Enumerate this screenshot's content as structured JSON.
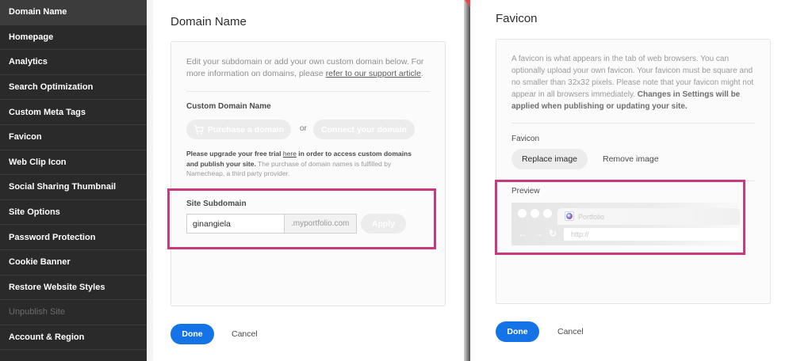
{
  "sidebar": {
    "items": [
      {
        "label": "Domain Name",
        "state": "active"
      },
      {
        "label": "Homepage",
        "state": "normal"
      },
      {
        "label": "Analytics",
        "state": "normal"
      },
      {
        "label": "Search Optimization",
        "state": "normal"
      },
      {
        "label": "Custom Meta Tags",
        "state": "normal"
      },
      {
        "label": "Favicon",
        "state": "normal"
      },
      {
        "label": "Web Clip Icon",
        "state": "normal"
      },
      {
        "label": "Social Sharing Thumbnail",
        "state": "normal"
      },
      {
        "label": "Site Options",
        "state": "normal"
      },
      {
        "label": "Password Protection",
        "state": "normal"
      },
      {
        "label": "Cookie Banner",
        "state": "normal"
      },
      {
        "label": "Restore Website Styles",
        "state": "normal"
      },
      {
        "label": "Unpublish Site",
        "state": "disabled"
      },
      {
        "label": "Account & Region",
        "state": "normal"
      }
    ]
  },
  "domain_panel": {
    "title": "Domain Name",
    "intro_text": "Edit your subdomain or add your own custom domain below. For more information on domains, please ",
    "intro_link": "refer to our support article",
    "intro_end": ".",
    "custom_domain_label": "Custom Domain Name",
    "purchase_button": "Purchase a domain",
    "or_text": "or",
    "connect_button": "Connect your domain",
    "upgrade_note_part1": "Please upgrade your free trial ",
    "upgrade_note_link": "here",
    "upgrade_note_part2": " in order to access custom domains and publish your site.",
    "upgrade_note_part3": " The purchase of domain names is fulfilled by Namecheap, a third party provider.",
    "subdomain_label": "Site Subdomain",
    "subdomain_value": "ginangiela",
    "subdomain_suffix": ".myportfolio.com",
    "apply_button": "Apply",
    "done_button": "Done",
    "cancel_button": "Cancel"
  },
  "favicon_panel": {
    "title": "Favicon",
    "description": "A favicon is what appears in the tab of web browsers. You can optionally upload your own favicon. Your favicon must be square and no smaller than 32x32 pixels. Please note that your favicon might not appear in all browsers immediately. ",
    "description_bold": "Changes in Settings will be applied when publishing or updating your site.",
    "favicon_label": "Favicon",
    "replace_button": "Replace image",
    "remove_button": "Remove image",
    "preview_label": "Preview",
    "preview_tab_label": "Portfolio",
    "preview_url": "http://",
    "done_button": "Done",
    "cancel_button": "Cancel"
  },
  "colors": {
    "accent": "#1473e6",
    "highlight": "#c73b7c",
    "sidebar_bg": "#2a2a2b"
  }
}
